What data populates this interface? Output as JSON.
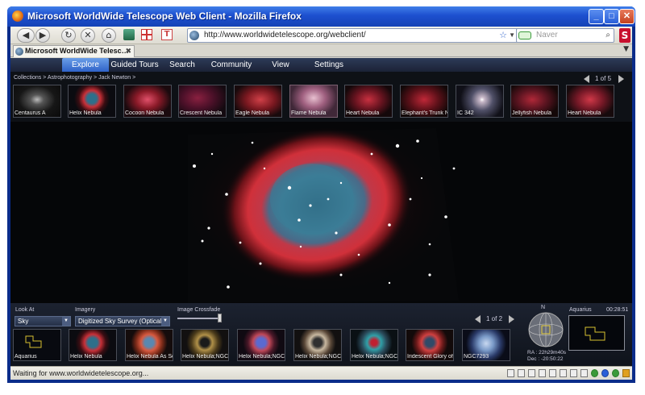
{
  "window": {
    "title": "Microsoft WorldWide Telescope Web Client - Mozilla Firefox",
    "min_label": "_",
    "max_label": "□",
    "close_label": "✕"
  },
  "navbar": {
    "back_label": "◀",
    "forward_label": "▶",
    "reload_label": "↻",
    "stop_label": "✕",
    "home_label": "⌂",
    "url": "http://www.worldwidetelescope.org/webclient/",
    "bookmark_star": "☆",
    "dropdown": "▼",
    "search_placeholder": "Naver",
    "search_glass": "⌕",
    "addon_label": "S"
  },
  "tabbar": {
    "tab_title": "Microsoft WorldWide Telesc…",
    "tab_close": "✖",
    "list_tabs": "▼"
  },
  "app": {
    "menu": [
      "Explore",
      "Guided Tours",
      "Search",
      "Community",
      "View",
      "Settings"
    ],
    "breadcrumb": "Collections  >  Astrophotography  >  Jack Newton  >",
    "top_pager": "1 of 5",
    "top_thumbnails": [
      "Centaurus A",
      "Helix Nebula",
      "Cocoon Nebula",
      "Crescent Nebula",
      "Eagle Nebula",
      "Flame Nebula",
      "Heart Nebula",
      "Elephant's Trunk N",
      "IC 342",
      "Jellyfish Nebula",
      "Heart Nebula"
    ],
    "look_at_label": "Look At",
    "look_at_value": "Sky",
    "imagery_label": "Imagery",
    "imagery_value": "Digitized Sky Survey (Optical)",
    "crossfade_label": "Image Crossfade",
    "crossfade_level": 0.9,
    "bottom_pager": "1 of 2",
    "bottom_thumbnails": [
      "Aquarius",
      "Helix Nebula",
      "Helix Nebula As Se",
      "Helix Nebula;NGC",
      "Helix Nebula;NGC",
      "Helix Nebula;NGC",
      "Helix Nebula;NGC",
      "Iridescent Glory of",
      "NGC7293"
    ],
    "compass_n": "N",
    "ra": "RA : 22h29m40s",
    "dec": "Dec : -20:50:22",
    "constellation": "Aquarius",
    "clock": "00:28:51"
  },
  "status": {
    "text": "Waiting for www.worldwidetelescope.org..."
  },
  "colors": {
    "xp_titlebar": "#1d4fcf",
    "app_menu": "#1b2236",
    "active_tab": "#2f62c8",
    "nebula_red": "#d0303a",
    "nebula_teal": "#3d7c96"
  }
}
